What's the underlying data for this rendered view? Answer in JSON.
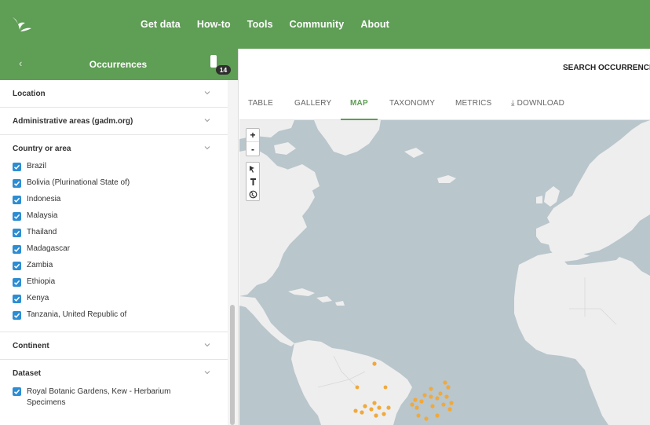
{
  "nav": {
    "items": [
      "Get data",
      "How-to",
      "Tools",
      "Community",
      "About"
    ]
  },
  "sidebar": {
    "title": "Occurrences",
    "filter_count": "14",
    "sections": {
      "location": "Location",
      "admin_areas": "Administrative areas (gadm.org)",
      "country": "Country or area",
      "continent": "Continent",
      "dataset": "Dataset"
    },
    "countries": [
      "Brazil",
      "Bolivia (Plurinational State of)",
      "Indonesia",
      "Malaysia",
      "Thailand",
      "Madagascar",
      "Zambia",
      "Ethiopia",
      "Kenya",
      "Tanzania, United Republic of"
    ],
    "datasets": [
      "Royal Botanic Gardens, Kew - Herbarium Specimens"
    ]
  },
  "content": {
    "search_label": "SEARCH OCCURRENCE",
    "tabs": [
      "TABLE",
      "GALLERY",
      "MAP",
      "TAXONOMY",
      "METRICS",
      "DOWNLOAD"
    ],
    "active_tab": "MAP"
  },
  "map": {
    "zoom_in": "+",
    "zoom_out": "-",
    "tools": [
      "select-icon",
      "pin-icon",
      "globe-icon"
    ],
    "colors": {
      "sea": "#b9c6cc",
      "land": "#eeeeee",
      "points": "#f0a93c"
    }
  },
  "colors": {
    "brand": "#5f9e55",
    "checkbox": "#2d8dd3"
  }
}
